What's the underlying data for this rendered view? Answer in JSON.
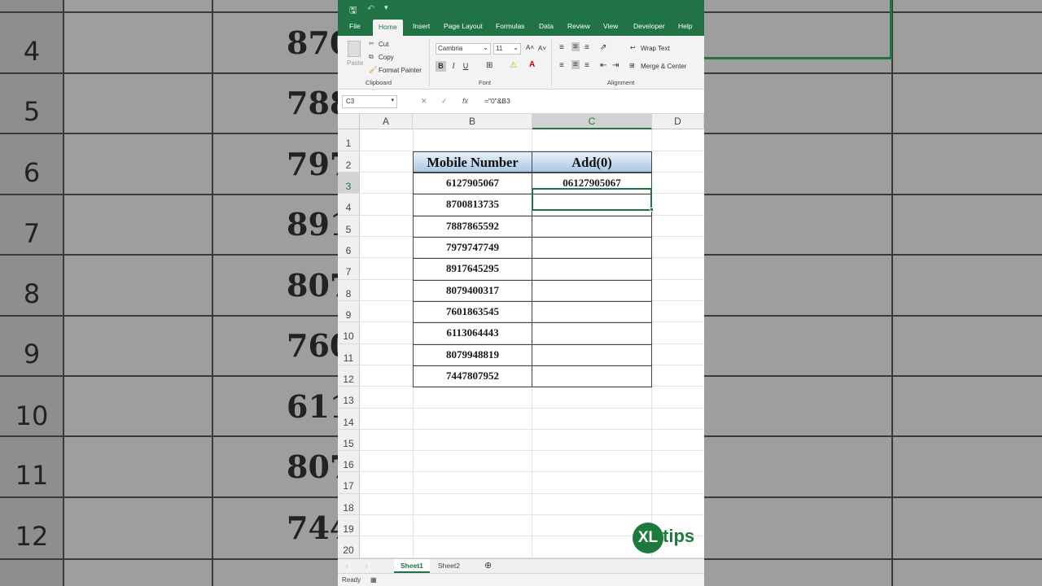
{
  "background": {
    "row_numbers": [
      "4",
      "5",
      "6",
      "7",
      "8",
      "9",
      "10",
      "11",
      "12"
    ],
    "values": [
      "870",
      "788",
      "797",
      "891",
      "807",
      "760",
      "611",
      "807",
      "744"
    ]
  },
  "quick_access": {
    "save_icon": "save-icon",
    "undo_icon": "undo-icon",
    "customize_icon": "customize-icon"
  },
  "tabs": [
    "File",
    "Home",
    "Insert",
    "Page Layout",
    "Formulas",
    "Data",
    "Review",
    "View",
    "Developer",
    "Help"
  ],
  "active_tab": "Home",
  "clipboard": {
    "paste": "Paste",
    "cut": "Cut",
    "copy": "Copy",
    "format_painter": "Format Painter",
    "group": "Clipboard"
  },
  "font": {
    "name": "Cambria",
    "size": "11",
    "bold": "B",
    "italic": "I",
    "underline": "U",
    "group": "Font"
  },
  "alignment": {
    "wrap_text": "Wrap Text",
    "merge_center": "Merge & Center",
    "group": "Alignment"
  },
  "formula_bar": {
    "name_box": "C3",
    "formula": "=\"0\"&B3",
    "fx": "fx"
  },
  "columns": [
    "A",
    "B",
    "C",
    "D"
  ],
  "rows": [
    "1",
    "2",
    "3",
    "4",
    "5",
    "6",
    "7",
    "8",
    "9",
    "10",
    "11",
    "12",
    "13",
    "14",
    "15",
    "16",
    "17",
    "18",
    "19",
    "20"
  ],
  "table": {
    "header_b": "Mobile Number",
    "header_c": "Add(0)",
    "mobile_numbers": [
      "6127905067",
      "8700813735",
      "7887865592",
      "7979747749",
      "8917645295",
      "8079400317",
      "7601863545",
      "6113064443",
      "8079948819",
      "7447807952"
    ],
    "add_zero": [
      "06127905067",
      "",
      "",
      "",
      "",
      "",
      "",
      "",
      "",
      ""
    ]
  },
  "sheets": [
    "Sheet1",
    "Sheet2"
  ],
  "active_sheet": "Sheet1",
  "status": "Ready",
  "logo": {
    "mark": "XL",
    "word": "tips"
  }
}
